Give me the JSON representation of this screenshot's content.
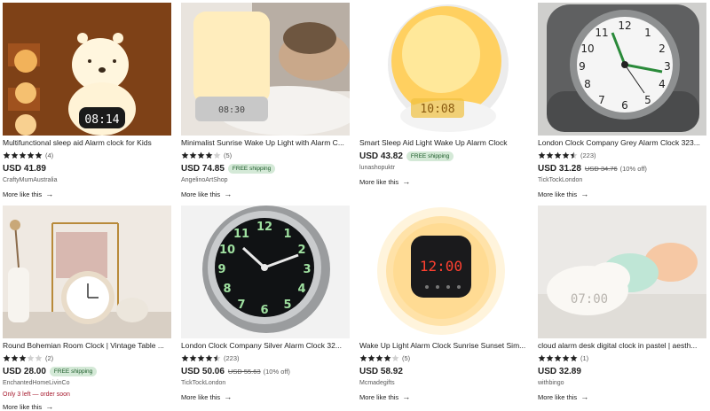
{
  "more_like_this_label": "More like this",
  "products": [
    {
      "title": "Multifunctional sleep aid Alarm clock for Kids",
      "rating": 5,
      "rating_count": "(4)",
      "price": "USD 41.89",
      "original_price": "",
      "discount": "",
      "free_shipping": "",
      "shop": "CraftyMumAustralia",
      "stock_note": "",
      "image": {
        "clock_display": "08:14"
      }
    },
    {
      "title": "Minimalist Sunrise Wake Up Light with Alarm C...",
      "rating": 4,
      "rating_count": "(5)",
      "price": "USD 74.85",
      "original_price": "",
      "discount": "",
      "free_shipping": "FREE shipping",
      "shop": "AngelinoArtShop",
      "stock_note": "",
      "image": {
        "clock_display": "08:30"
      }
    },
    {
      "title": "Smart Sleep Aid Light Wake Up Alarm Clock",
      "rating": 0,
      "rating_count": "",
      "price": "USD 43.82",
      "original_price": "",
      "discount": "",
      "free_shipping": "FREE shipping",
      "shop": "lunashopuktr",
      "stock_note": "",
      "image": {
        "clock_display": "10:08"
      }
    },
    {
      "title": "London Clock Company Grey Alarm Clock 323...",
      "rating": 4.5,
      "rating_count": "(223)",
      "price": "USD 31.28",
      "original_price": "USD 34.76",
      "discount": "(10% off)",
      "free_shipping": "",
      "shop": "TickTockLondon",
      "stock_note": "",
      "image": {
        "clock_display": ""
      }
    },
    {
      "title": "Round Bohemian Room Clock | Vintage Table ...",
      "rating": 3,
      "rating_count": "(2)",
      "price": "USD 28.00",
      "original_price": "",
      "discount": "",
      "free_shipping": "FREE shipping",
      "shop": "EnchantedHomeLivinCo",
      "stock_note": "Only 3 left — order soon",
      "image": {
        "clock_display": ""
      }
    },
    {
      "title": "London Clock Company Silver Alarm Clock 32...",
      "rating": 4.5,
      "rating_count": "(223)",
      "price": "USD 50.06",
      "original_price": "USD 55.63",
      "discount": "(10% off)",
      "free_shipping": "",
      "shop": "TickTockLondon",
      "stock_note": "",
      "image": {
        "clock_display": ""
      }
    },
    {
      "title": "Wake Up Light Alarm Clock Sunrise Sunset Sim...",
      "rating": 4,
      "rating_count": "(5)",
      "price": "USD 58.92",
      "original_price": "",
      "discount": "",
      "free_shipping": "",
      "shop": "Mcmadegifts",
      "stock_note": "",
      "image": {
        "clock_display": "12:00"
      }
    },
    {
      "title": "cloud alarm desk digital clock in pastel | aesth...",
      "rating": 5,
      "rating_count": "(1)",
      "price": "USD 32.89",
      "original_price": "",
      "discount": "",
      "free_shipping": "",
      "shop": "withbingo",
      "stock_note": "",
      "image": {
        "clock_display": "07:00"
      }
    }
  ]
}
